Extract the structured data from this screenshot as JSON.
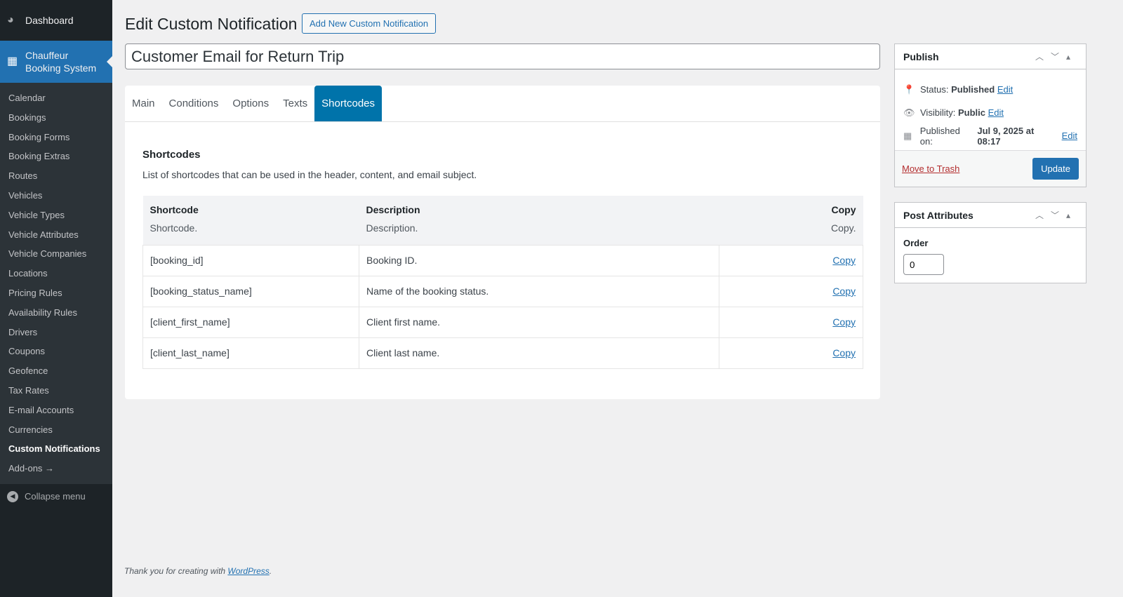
{
  "sidebar": {
    "dashboard": "Dashboard",
    "plugin": "Chauffeur Booking System",
    "items": [
      "Calendar",
      "Bookings",
      "Booking Forms",
      "Booking Extras",
      "Routes",
      "Vehicles",
      "Vehicle Types",
      "Vehicle Attributes",
      "Vehicle Companies",
      "Locations",
      "Pricing Rules",
      "Availability Rules",
      "Drivers",
      "Coupons",
      "Geofence",
      "Tax Rates",
      "E-mail Accounts",
      "Currencies",
      "Custom Notifications",
      "Add-ons →"
    ],
    "current": "Custom Notifications",
    "collapse": "Collapse menu"
  },
  "header": {
    "title": "Edit Custom Notification",
    "add_new": "Add New Custom Notification"
  },
  "post_title": "Customer Email for Return Trip",
  "tabs": [
    "Main",
    "Conditions",
    "Options",
    "Texts",
    "Shortcodes"
  ],
  "active_tab": "Shortcodes",
  "shortcodes": {
    "heading": "Shortcodes",
    "description": "List of shortcodes that can be used in the header, content, and email subject.",
    "columns": [
      {
        "title": "Shortcode",
        "sub": "Shortcode."
      },
      {
        "title": "Description",
        "sub": "Description."
      },
      {
        "title": "Copy",
        "sub": "Copy."
      }
    ],
    "rows": [
      {
        "code": "[booking_id]",
        "desc": "Booking ID.",
        "copy": "Copy"
      },
      {
        "code": "[booking_status_name]",
        "desc": "Name of the booking status.",
        "copy": "Copy"
      },
      {
        "code": "[client_first_name]",
        "desc": "Client first name.",
        "copy": "Copy"
      },
      {
        "code": "[client_last_name]",
        "desc": "Client last name.",
        "copy": "Copy"
      }
    ]
  },
  "publish": {
    "title": "Publish",
    "status_label": "Status:",
    "status": "Published",
    "visibility_label": "Visibility:",
    "visibility": "Public",
    "published_label": "Published on:",
    "published": "Jul 9, 2025 at 08:17",
    "edit": "Edit",
    "trash": "Move to Trash",
    "update": "Update"
  },
  "attributes": {
    "title": "Post Attributes",
    "order_label": "Order",
    "order": "0"
  },
  "footer": {
    "text": "Thank you for creating with ",
    "link": "WordPress",
    "end": "."
  }
}
